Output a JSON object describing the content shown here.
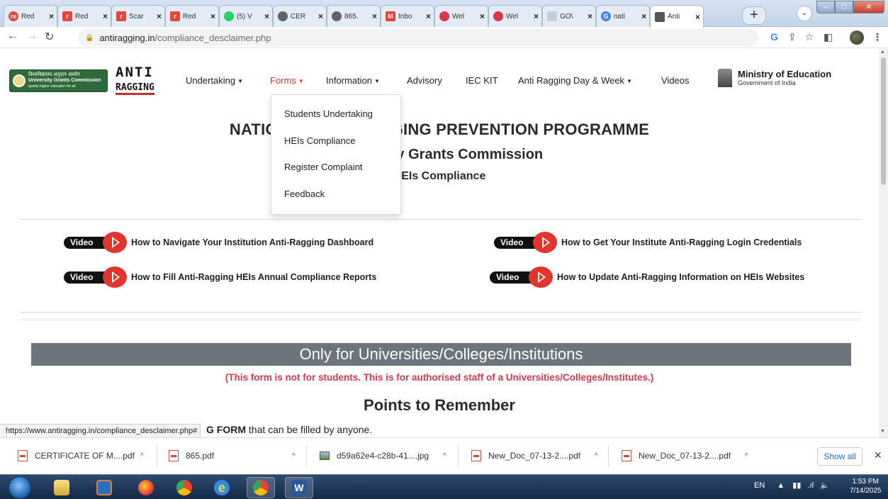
{
  "browser": {
    "tabs": [
      {
        "label": "Red",
        "favicon_color": "#e8453c",
        "favicon_text": "re",
        "sq": false
      },
      {
        "label": "Red",
        "favicon_color": "#e8453c",
        "favicon_text": "r",
        "sq": true
      },
      {
        "label": "Scar",
        "favicon_color": "#e8453c",
        "favicon_text": "r",
        "sq": true
      },
      {
        "label": "Red",
        "favicon_color": "#e8453c",
        "favicon_text": "r",
        "sq": true
      },
      {
        "label": "(5) V",
        "favicon_color": "#25d366",
        "favicon_text": "",
        "sq": false
      },
      {
        "label": "CER",
        "favicon_color": "#5f6368",
        "favicon_text": "",
        "sq": false
      },
      {
        "label": "865.",
        "favicon_color": "#5f6368",
        "favicon_text": "",
        "sq": false
      },
      {
        "label": "Inbo",
        "favicon_color": "#ea4335",
        "favicon_text": "M",
        "sq": true
      },
      {
        "label": "Wel",
        "favicon_color": "#d9364a",
        "favicon_text": "",
        "sq": false
      },
      {
        "label": "Wel",
        "favicon_color": "#d9364a",
        "favicon_text": "",
        "sq": false
      },
      {
        "label": "GO\\",
        "favicon_color": "#c5ccd6",
        "favicon_text": "",
        "sq": true
      },
      {
        "label": "nati",
        "favicon_color": "#4285f4",
        "favicon_text": "G",
        "sq": false
      },
      {
        "label": "Anti",
        "favicon_color": "#555555",
        "favicon_text": "",
        "sq": true,
        "active": true
      }
    ],
    "close_glyph": "×",
    "new_tab_glyph": "+",
    "url_host": "antiragging.in",
    "url_path": "/compliance_desclaimer.php",
    "status_url": "https://www.antiragging.in/compliance_desclaimer.php#"
  },
  "nav": {
    "ugc_hindi": "विश्वविद्यालय अनुदान आयोग",
    "ugc_name": "University Grants Commission",
    "ugc_tag": "quality higher education for all",
    "anti_l1": "ANTI",
    "anti_l2": "RAGGING",
    "items": {
      "undertaking": "Undertaking",
      "forms": "Forms",
      "information": "Information",
      "advisory": "Advisory",
      "iec": "IEC KIT",
      "day_week": "Anti Ragging Day & Week",
      "videos": "Videos"
    },
    "moe_title": "Ministry of Education",
    "moe_sub": "Government of India"
  },
  "forms_menu": [
    "Students Undertaking",
    "HEIs Compliance",
    "Register Complaint",
    "Feedback"
  ],
  "headings": {
    "program": "NATIONAL ANTI-RAGGING PREVENTION PROGRAMME",
    "ugc": "University Grants Commission",
    "hei": "HEIs Compliance"
  },
  "videos": {
    "badge": "Video",
    "items": [
      "How to Navigate Your Institution Anti-Ragging Dashboard",
      "How to Get Your Institute Anti-Ragging Login Credentials",
      "How to Fill Anti-Ragging HEIs Annual Compliance Reports",
      "How to Update Anti-Ragging Information on HEIs Websites"
    ]
  },
  "banner": "Only for Universities/Colleges/Institutions",
  "note": "(This form is not for students. This is for authorised staff of a Universities/Colleges/Institutes.)",
  "points_title": "Points to Remember",
  "points_line_bold": "G FORM",
  "points_line_rest": " that can be filled by anyone.",
  "downloads": [
    {
      "name": "CERTIFICATE OF M....pdf",
      "type": "pdf"
    },
    {
      "name": "865.pdf",
      "type": "pdf"
    },
    {
      "name": "d59a62e4-c28b-41....jpg",
      "type": "img"
    },
    {
      "name": "New_Doc_07-13-2....pdf",
      "type": "pdf"
    },
    {
      "name": "New_Doc_07-13-2....pdf",
      "type": "pdf"
    }
  ],
  "show_all": "Show all",
  "taskbar": {
    "lang": "EN",
    "time": "1:53 PM",
    "date": "7/14/2025"
  },
  "colors": {
    "accent_red": "#e3342f",
    "banner_grey": "#6c757d",
    "note_red": "#d9364a"
  }
}
